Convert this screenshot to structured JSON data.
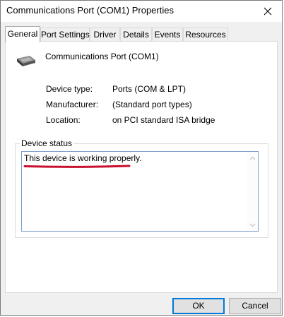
{
  "window": {
    "title": "Communications Port (COM1) Properties",
    "close_icon": "close-icon"
  },
  "tabs": [
    {
      "label": "General",
      "active": true
    },
    {
      "label": "Port Settings",
      "active": false
    },
    {
      "label": "Driver",
      "active": false
    },
    {
      "label": "Details",
      "active": false
    },
    {
      "label": "Events",
      "active": false
    },
    {
      "label": "Resources",
      "active": false
    }
  ],
  "device": {
    "icon": "serial-port-icon",
    "name": "Communications Port (COM1)"
  },
  "properties": [
    {
      "label": "Device type:",
      "value": "Ports (COM & LPT)"
    },
    {
      "label": "Manufacturer:",
      "value": "(Standard port types)"
    },
    {
      "label": "Location:",
      "value": "on PCI standard ISA bridge"
    }
  ],
  "status": {
    "group_label": "Device status",
    "text": "This device is working properly.",
    "highlight_color": "#c8102e"
  },
  "buttons": {
    "ok": "OK",
    "cancel": "Cancel"
  },
  "colors": {
    "accent": "#0078d7",
    "window_bg": "#f0f0f0"
  }
}
